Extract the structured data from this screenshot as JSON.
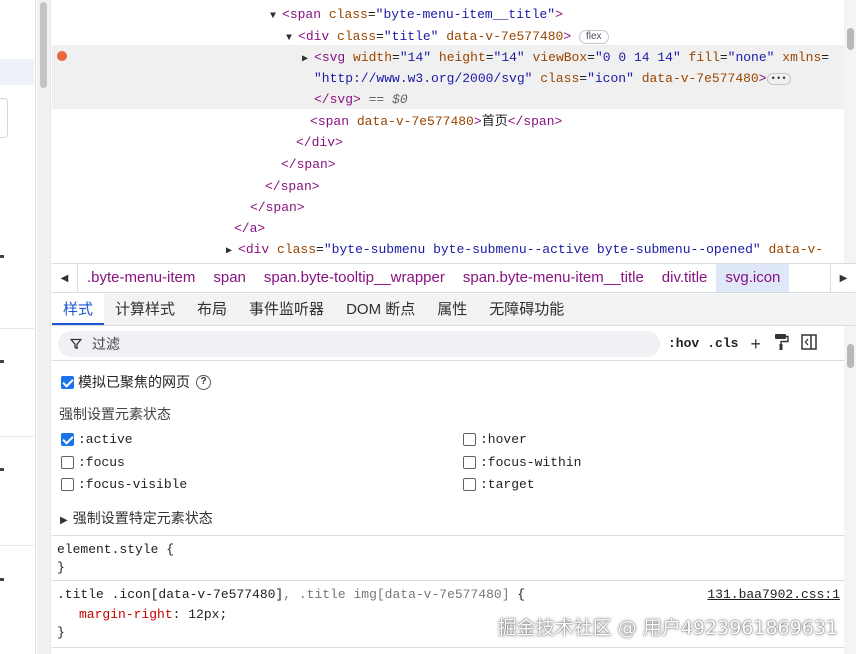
{
  "dom_tree": {
    "lines": [
      {
        "open": "<",
        "tag": "span",
        "attrs": [
          {
            "name": "class",
            "value": "\"byte-menu-item__title\""
          }
        ],
        "close": ">"
      },
      {
        "open": "<",
        "tag": "div",
        "attrs": [
          {
            "name": "class",
            "value": "\"title\""
          },
          {
            "name": "data-v-7e577480",
            "value": ""
          }
        ],
        "close": ">",
        "badge": "flex"
      },
      {
        "open": "<",
        "tag": "svg",
        "attrs": [
          {
            "name": "width",
            "value": "\"14\""
          },
          {
            "name": "height",
            "value": "\"14\""
          },
          {
            "name": "viewBox",
            "value": "\"0 0 14 14\""
          },
          {
            "name": "fill",
            "value": "\"none\""
          },
          {
            "name": "xmlns",
            "value": ""
          }
        ]
      },
      {
        "cont_value": "\"http://www.w3.org/2000/svg\"",
        "attrs": [
          {
            "name": "class",
            "value": "\"icon\""
          },
          {
            "name": "data-v-7e577480",
            "value": ""
          }
        ],
        "close": ">"
      },
      {
        "close_tag": "</svg>",
        "suffix": "== $0"
      },
      {
        "open": "<",
        "tag": "span",
        "attrs": [
          {
            "name": "data-v-7e577480",
            "value": ""
          }
        ],
        "close": ">",
        "text": "首页",
        "end": "</span>"
      },
      {
        "close_tag": "</div>"
      },
      {
        "close_tag": "</span>"
      },
      {
        "close_tag": "</span>"
      },
      {
        "close_tag": "</span>"
      },
      {
        "close_tag": "</a>"
      },
      {
        "open": "<",
        "tag": "div",
        "attrs": [
          {
            "name": "class",
            "value": "\"byte-submenu byte-submenu--active byte-submenu--opened\""
          },
          {
            "name": "data-v-",
            "value": ""
          }
        ]
      }
    ],
    "ellipsis": "•••"
  },
  "breadcrumb": {
    "items": [
      ".byte-menu-item",
      "span",
      "span.byte-tooltip__wrapper",
      "span.byte-menu-item__title",
      "div.title",
      "svg.icon"
    ],
    "active_index": 5
  },
  "tabs": [
    "样式",
    "计算样式",
    "布局",
    "事件监听器",
    "DOM 断点",
    "属性",
    "无障碍功能"
  ],
  "filter": {
    "placeholder": "过滤",
    "hov": ":hov",
    "cls": ".cls"
  },
  "state_panel": {
    "emulate_label": "模拟已聚焦的网页",
    "force_title": "强制设置元素状态",
    "states": [
      {
        "label": ":active",
        "checked": true
      },
      {
        "label": ":hover",
        "checked": false
      },
      {
        "label": ":focus",
        "checked": false
      },
      {
        "label": ":focus-within",
        "checked": false
      },
      {
        "label": ":focus-visible",
        "checked": false
      },
      {
        "label": ":target",
        "checked": false
      }
    ],
    "specific_label": "强制设置特定元素状态"
  },
  "rules": {
    "element_style": {
      "selector": "element.style {",
      "close": "}"
    },
    "title_icon": {
      "selector_a": ".title .icon[data-v-7e577480]",
      "selector_sep": ", ",
      "selector_b": ".title img[data-v-7e577480]",
      "brace": " {",
      "property": "margin-right",
      "value": "12px;",
      "close": "}",
      "source": "131.baa7902.css:1"
    }
  },
  "watermark": "掘金技术社区 @ 用户4923961869631",
  "colors": {
    "accent": "#1a73e8",
    "tag": "#881280",
    "attr_name": "#994500",
    "attr_value": "#1a1aa6",
    "css_property": "#c80000",
    "breakpoint": "#e8683a"
  }
}
